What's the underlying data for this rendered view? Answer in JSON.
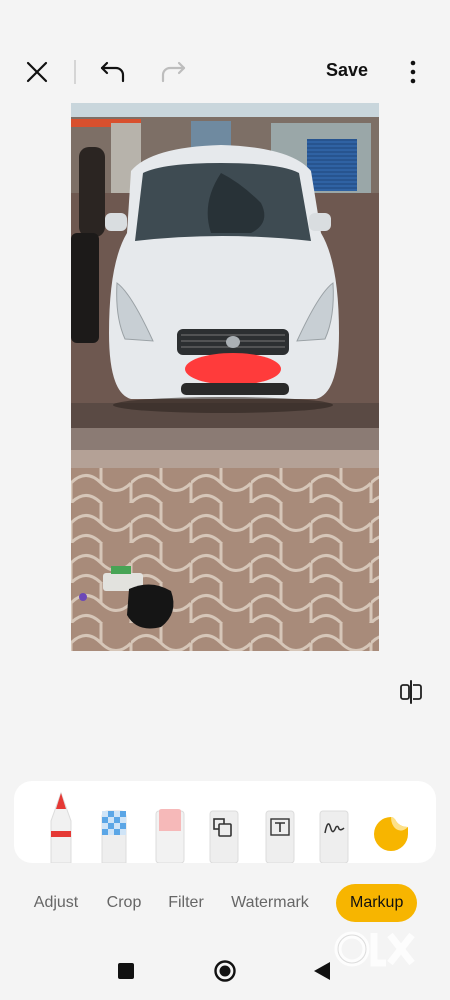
{
  "toolbar": {
    "save_label": "Save"
  },
  "icons": {
    "close": "close-icon",
    "undo": "undo-icon",
    "redo": "redo-icon",
    "more": "more-vertical-icon",
    "compare": "compare-icon"
  },
  "markup_tools": [
    {
      "name": "pen-tool",
      "icon": "pen-icon"
    },
    {
      "name": "mosaic-tool",
      "icon": "mosaic-icon"
    },
    {
      "name": "eraser-tool",
      "icon": "eraser-icon"
    },
    {
      "name": "shape-tool",
      "icon": "shape-icon"
    },
    {
      "name": "text-tool",
      "icon": "text-icon"
    },
    {
      "name": "signature-tool",
      "icon": "signature-icon"
    },
    {
      "name": "sticker-tool",
      "icon": "sticker-icon"
    }
  ],
  "tabs": [
    {
      "label": "Adjust",
      "active": false
    },
    {
      "label": "Crop",
      "active": false
    },
    {
      "label": "Filter",
      "active": false
    },
    {
      "label": "Watermark",
      "active": false
    },
    {
      "label": "Markup",
      "active": true
    }
  ],
  "navigation": {
    "recents": "square-icon",
    "home": "circle-icon",
    "back": "triangle-back-icon"
  },
  "watermark": {
    "brand": "OLX"
  },
  "colors": {
    "accent": "#f7b500",
    "background": "#f4f4f4",
    "tray": "#ffffff",
    "pen_red": "#e53935",
    "redaction_red": "#ff3b3b"
  }
}
